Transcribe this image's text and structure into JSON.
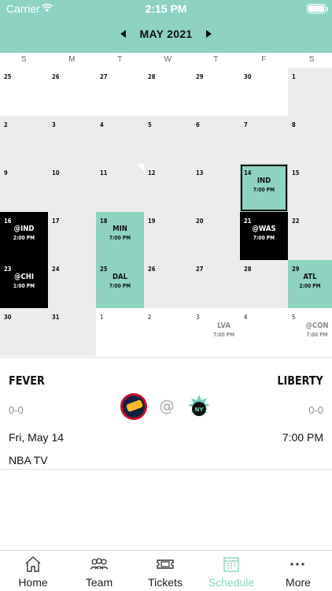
{
  "status_bar": {
    "carrier": "Carrier",
    "time": "2:15 PM"
  },
  "calendar": {
    "month_title": "MAY 2021",
    "weekdays": [
      "S",
      "M",
      "T",
      "W",
      "T",
      "F",
      "S"
    ],
    "weeks": [
      [
        {
          "day": "25"
        },
        {
          "day": "26"
        },
        {
          "day": "27"
        },
        {
          "day": "28"
        },
        {
          "day": "29"
        },
        {
          "day": "30"
        },
        {
          "day": "1"
        }
      ],
      [
        {
          "day": "2"
        },
        {
          "day": "3"
        },
        {
          "day": "4"
        },
        {
          "day": "5"
        },
        {
          "day": "6"
        },
        {
          "day": "7"
        },
        {
          "day": "8"
        }
      ],
      [
        {
          "day": "9"
        },
        {
          "day": "10"
        },
        {
          "day": "11"
        },
        {
          "day": "12"
        },
        {
          "day": "13"
        },
        {
          "day": "14",
          "opponent": "IND",
          "time": "7:00 PM"
        },
        {
          "day": "15"
        }
      ],
      [
        {
          "day": "16",
          "opponent": "@IND",
          "time": "2:00 PM"
        },
        {
          "day": "17"
        },
        {
          "day": "18",
          "opponent": "MIN",
          "time": "7:00 PM"
        },
        {
          "day": "19"
        },
        {
          "day": "20"
        },
        {
          "day": "21",
          "opponent": "@WAS",
          "time": "7:00 PM"
        },
        {
          "day": "22"
        }
      ],
      [
        {
          "day": "23",
          "opponent": "@CHI",
          "time": "1:00 PM"
        },
        {
          "day": "24"
        },
        {
          "day": "25",
          "opponent": "DAL",
          "time": "7:00 PM"
        },
        {
          "day": "26"
        },
        {
          "day": "27"
        },
        {
          "day": "28"
        },
        {
          "day": "29",
          "opponent": "ATL",
          "time": "2:00 PM"
        }
      ],
      [
        {
          "day": "30"
        },
        {
          "day": "31"
        },
        {
          "day": "1"
        },
        {
          "day": "2"
        },
        {
          "day": "3",
          "opponent": "LVA",
          "time": "7:00 PM"
        },
        {
          "day": "4"
        },
        {
          "day": "5",
          "opponent": "@CON",
          "time": "7:00 PM"
        }
      ]
    ]
  },
  "game_detail": {
    "away_team": "FEVER",
    "home_team": "LIBERTY",
    "away_record": "0-0",
    "home_record": "0-0",
    "at_symbol": "@",
    "date": "Fri, May 14",
    "time": "7:00 PM",
    "network": "NBA TV"
  },
  "tabbar": {
    "tabs": [
      {
        "label": "Home",
        "icon": "house-icon"
      },
      {
        "label": "Team",
        "icon": "people-icon"
      },
      {
        "label": "Tickets",
        "icon": "ticket-icon"
      },
      {
        "label": "Schedule",
        "icon": "calendar-icon"
      },
      {
        "label": "More",
        "icon": "ellipsis-icon"
      }
    ]
  },
  "colors": {
    "accent": "#8dd3c0",
    "away_game": "#000000",
    "cell_gray": "#ececec"
  }
}
